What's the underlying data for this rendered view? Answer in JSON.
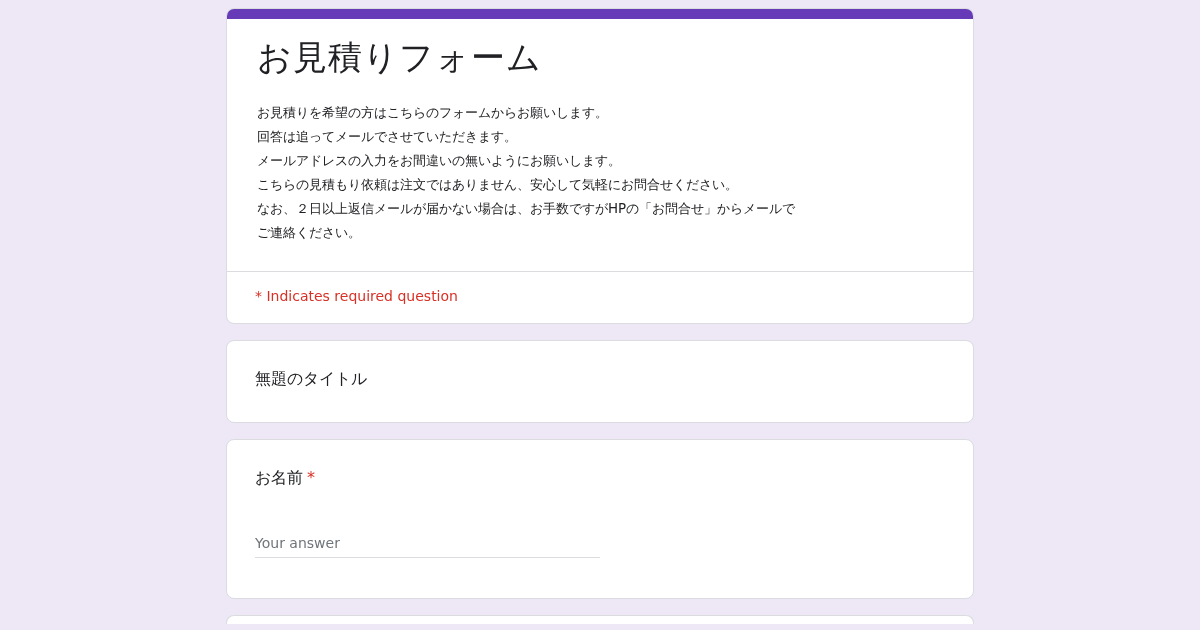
{
  "form": {
    "title": "お見積りフォーム",
    "description": [
      "お見積りを希望の方はこちらのフォームからお願いします。",
      "回答は追ってメールでさせていただきます。",
      "メールアドレスの入力をお間違いの無いようにお願いします。",
      "こちらの見積もり依頼は注文ではありません、安心して気軽にお問合せください。",
      "なお、２日以上返信メールが届かない場合は、お手数ですがHPの「お問合せ」からメールで",
      "ご連絡ください。"
    ],
    "required_note": "* Indicates required question"
  },
  "items": [
    {
      "kind": "section",
      "title": "無題のタイトル"
    },
    {
      "kind": "question",
      "title": "お名前",
      "required": true,
      "required_mark": "*",
      "placeholder": "Your answer"
    }
  ]
}
